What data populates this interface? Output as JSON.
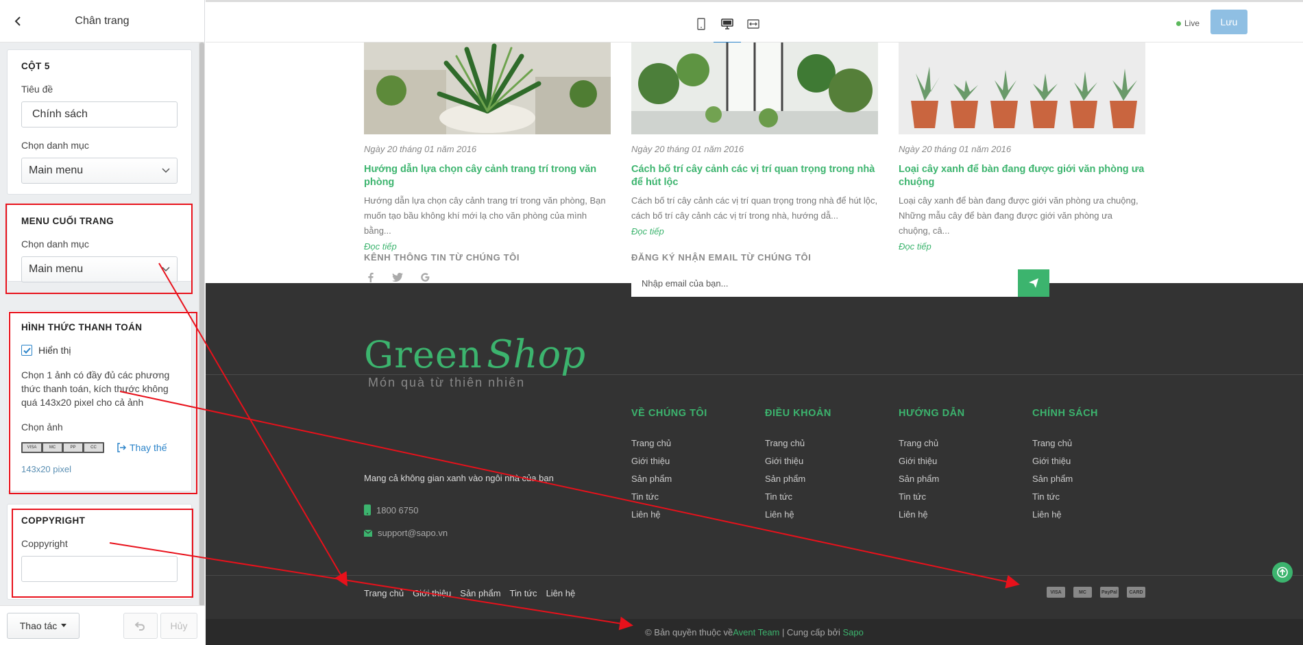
{
  "sidebar": {
    "title": "Chân trang",
    "col5": {
      "title": "CỘT 5",
      "heading_label": "Tiêu đề",
      "heading_value": "Chính sách",
      "category_label": "Chọn danh mục",
      "category_value": "Main menu"
    },
    "footer_menu": {
      "title": "MENU CUỐI TRANG",
      "category_label": "Chọn danh mục",
      "category_value": "Main menu"
    },
    "payment": {
      "title": "HÌNH THỨC THANH TOÁN",
      "show_label": "Hiển thị",
      "show_checked": true,
      "help": "Chọn 1 ảnh có đầy đủ các phương thức thanh toán, kích thước không quá 143x20 pixel cho cả ảnh",
      "image_label": "Chọn ảnh",
      "replace_label": "Thay thế",
      "size_note": "143x20 pixel"
    },
    "copyright": {
      "title": "COPPYRIGHT",
      "label": "Coppyright",
      "value": ""
    },
    "footer": {
      "actions_label": "Thao tác",
      "cancel_label": "Hủy"
    }
  },
  "topbar": {
    "live_label": "Live",
    "save_label": "Lưu",
    "devices": [
      "mobile-icon",
      "desktop-icon",
      "fullwidth-icon"
    ],
    "active_device": "desktop-icon"
  },
  "preview": {
    "posts": [
      {
        "date": "Ngày 20 tháng 01 năm 2016",
        "title": "Hướng dẫn lựa chọn cây cảnh trang trí trong văn phòng",
        "excerpt": "Hướng dẫn lựa chọn cây cảnh trang trí trong văn phòng, Bạn muốn tạo bầu không khí mới lạ cho văn phòng của mình bằng...",
        "more": "Đọc tiếp"
      },
      {
        "date": "Ngày 20 tháng 01 năm 2016",
        "title": "Cách bố trí cây cảnh các vị trí quan trọng trong nhà để hút lộc",
        "excerpt": "Cách bố trí cây cảnh các vị trí quan trọng trong nhà để hút lộc, cách bố trí cây cảnh các vị trí trong nhà, hướng dẫ...",
        "more": "Đọc tiếp"
      },
      {
        "date": "Ngày 20 tháng 01 năm 2016",
        "title": "Loại cây xanh để bàn đang được giới văn phòng ưa chuộng",
        "excerpt": "Loại cây xanh để bàn đang được giới văn phòng ưa chuộng, Những mẫu cây để bàn đang được giới văn phòng ưa chuộng, câ...",
        "more": "Đọc tiếp"
      }
    ],
    "footer": {
      "social_heading": "KÊNH THÔNG TIN TỪ CHÚNG TÔI",
      "social_icons": [
        "facebook-icon",
        "twitter-icon",
        "google-icon"
      ],
      "newsletter_heading": "ĐĂNG KÝ NHẬN EMAIL TỪ CHÚNG TÔI",
      "email_placeholder": "Nhập email của bạn...",
      "logo_green": "Green",
      "logo_shop": "Shop",
      "logo_slogan": "Món quà từ thiên nhiên",
      "tagline": "Mang cả không gian xanh vào ngôi nhà của bạn",
      "phone": "1800 6750",
      "email": "support@sapo.vn",
      "columns": [
        {
          "title": "VỀ CHÚNG TÔI",
          "links": [
            "Trang chủ",
            "Giới thiệu",
            "Sản phẩm",
            "Tin tức",
            "Liên hệ"
          ]
        },
        {
          "title": "ĐIỀU KHOẢN",
          "links": [
            "Trang chủ",
            "Giới thiệu",
            "Sản phẩm",
            "Tin tức",
            "Liên hệ"
          ]
        },
        {
          "title": "HƯỚNG DẪN",
          "links": [
            "Trang chủ",
            "Giới thiệu",
            "Sản phẩm",
            "Tin tức",
            "Liên hệ"
          ]
        },
        {
          "title": "CHÍNH SÁCH",
          "links": [
            "Trang chủ",
            "Giới thiệu",
            "Sản phẩm",
            "Tin tức",
            "Liên hệ"
          ]
        }
      ],
      "bottom_links": [
        "Trang chủ",
        "Giới thiệu",
        "Sản phẩm",
        "Tin tức",
        "Liên hệ"
      ],
      "payment_icons": [
        "VISA",
        "MC",
        "PayPal",
        "CARD"
      ],
      "copyright_prefix": "© Bản quyền thuộc về ",
      "copyright_team": "Avent Team",
      "copyright_mid": " | Cung cấp bởi ",
      "copyright_provider": "Sapo"
    }
  },
  "colors": {
    "accent_green": "#3cb46e",
    "primary_blue": "#2a83c9",
    "annotation_red": "#e8111b",
    "footer_dark": "#333333"
  }
}
